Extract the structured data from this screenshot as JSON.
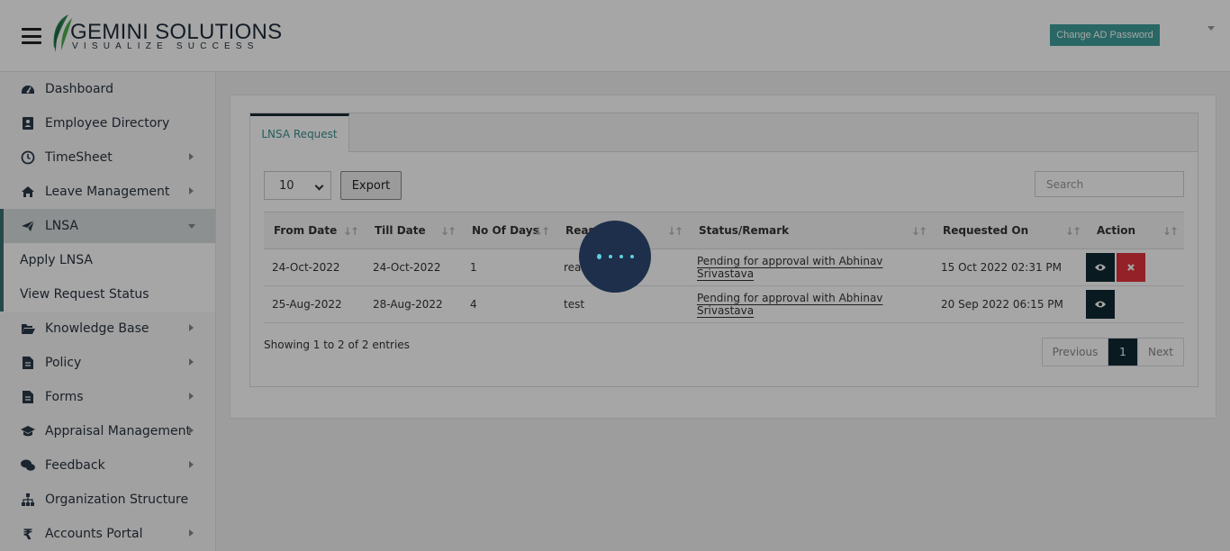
{
  "header": {
    "logo_title": "GEMINI SOLUTIONS",
    "logo_tagline": "VISUALIZE SUCCESS",
    "change_password_label": "Change AD Password"
  },
  "sidebar": {
    "items": [
      {
        "label": "Dashboard",
        "icon": "dashboard-icon"
      },
      {
        "label": "Employee Directory",
        "icon": "contact-card-icon"
      },
      {
        "label": "TimeSheet",
        "icon": "clock-icon"
      },
      {
        "label": "Leave Management",
        "icon": "home-icon"
      },
      {
        "label": "LNSA",
        "icon": "paper-plane-icon"
      },
      {
        "label": "Knowledge Base",
        "icon": "folder-open-icon"
      },
      {
        "label": "Policy",
        "icon": "document-icon"
      },
      {
        "label": "Forms",
        "icon": "document-icon"
      },
      {
        "label": "Appraisal Management",
        "icon": "graduation-cap-icon"
      },
      {
        "label": "Feedback",
        "icon": "chat-bubbles-icon"
      },
      {
        "label": "Organization Structure",
        "icon": "sitemap-icon"
      },
      {
        "label": "Accounts Portal",
        "icon": "rupee-icon"
      }
    ],
    "sub_items": [
      "Apply LNSA",
      "View Request Status"
    ]
  },
  "tabs": [
    "LNSA Request"
  ],
  "controls": {
    "page_length": "10",
    "export_label": "Export",
    "search_placeholder": "Search"
  },
  "table": {
    "columns": [
      "From Date",
      "Till Date",
      "No Of Days",
      "Reason",
      "Status/Remark",
      "Requested On",
      "Action"
    ],
    "rows": [
      {
        "from": "24-Oct-2022",
        "till": "24-Oct-2022",
        "days": "1",
        "reason": "reason",
        "status": "Pending for approval with Abhinav Srivastava",
        "requested": "15 Oct 2022 02:31 PM"
      },
      {
        "from": "25-Aug-2022",
        "till": "28-Aug-2022",
        "days": "4",
        "reason": "test",
        "status": "Pending for approval with Abhinav Srivastava",
        "requested": "20 Sep 2022 06:15 PM"
      }
    ]
  },
  "footer": {
    "info": "Showing 1 to 2 of 2 entries",
    "prev": "Previous",
    "current_page": "1",
    "next": "Next"
  },
  "colors": {
    "accent": "#3f9f9c",
    "dark": "#0f2a33",
    "danger": "#e2343d",
    "overlay": "rgba(0,0,0,0.35)"
  }
}
